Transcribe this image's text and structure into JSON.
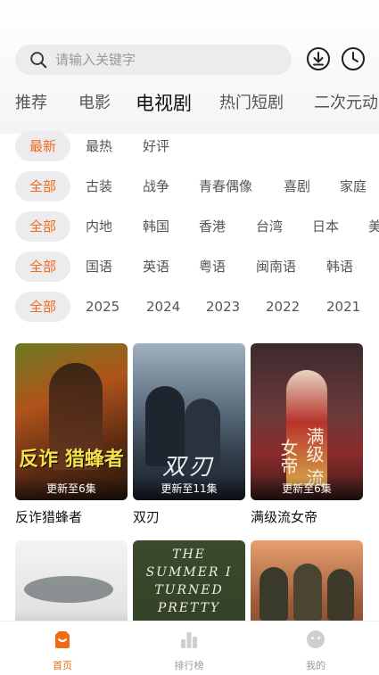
{
  "search": {
    "placeholder": "请输入关键字"
  },
  "main_tabs": [
    {
      "label": "推荐"
    },
    {
      "label": "电影"
    },
    {
      "label": "电视剧",
      "active": true
    },
    {
      "label": "热门短剧"
    },
    {
      "label": "二次元动"
    }
  ],
  "filters": {
    "sort": [
      "最新",
      "最热",
      "好评"
    ],
    "genre": [
      "全部",
      "古装",
      "战争",
      "青春偶像",
      "喜剧",
      "家庭"
    ],
    "region": [
      "全部",
      "内地",
      "韩国",
      "香港",
      "台湾",
      "日本",
      "美"
    ],
    "language": [
      "全部",
      "国语",
      "英语",
      "粤语",
      "闽南语",
      "韩语"
    ],
    "year": [
      "全部",
      "2025",
      "2024",
      "2023",
      "2022",
      "2021"
    ]
  },
  "cards": [
    {
      "title": "反诈猎蜂者",
      "badge": "更新至6集",
      "poster_text": "反诈 猎蜂者"
    },
    {
      "title": "双刃",
      "badge": "更新至11集",
      "poster_text": "双刃"
    },
    {
      "title": "满级流女帝",
      "badge": "更新至6集",
      "poster_text": "满级 流女帝"
    },
    {
      "title": "",
      "badge": "",
      "poster_text": ""
    },
    {
      "title": "",
      "badge": "",
      "poster_text": "THE SUMMER I TURNED PRETTY"
    },
    {
      "title": "",
      "badge": "",
      "poster_text": ""
    }
  ],
  "bottom_nav": [
    {
      "label": "首页",
      "icon": "home-icon",
      "active": true
    },
    {
      "label": "排行榜",
      "icon": "ranking-icon"
    },
    {
      "label": "我的",
      "icon": "profile-icon"
    }
  ],
  "colors": {
    "accent": "#f06a17",
    "chip_bg": "#ececee"
  }
}
